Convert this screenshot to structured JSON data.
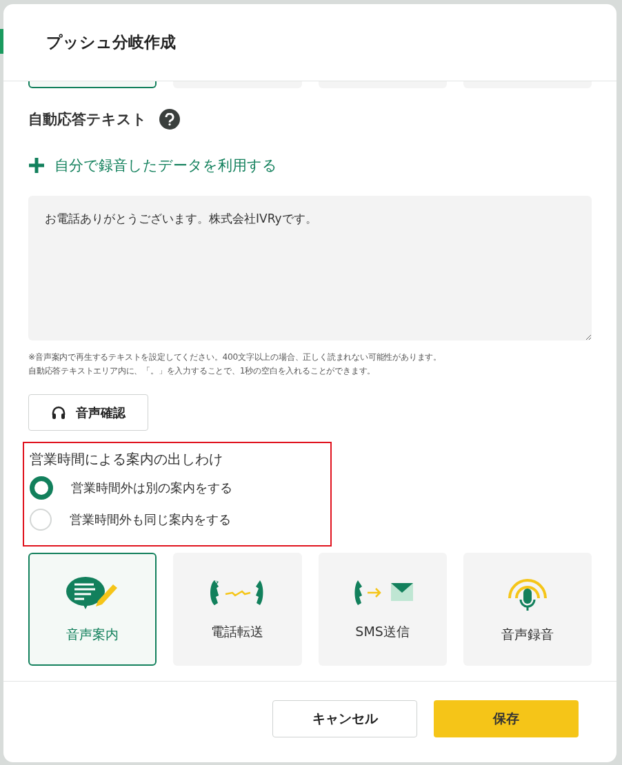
{
  "dialog": {
    "title": "プッシュ分岐作成"
  },
  "auto_text": {
    "label": "自動応答テキスト",
    "add_link": "自分で録音したデータを利用する",
    "value": "お電話ありがとうございます。株式会社IVRyです。",
    "notes": [
      "※音声案内で再生するテキストを設定してください。400文字以上の場合、正しく読まれない可能性があります。",
      "自動応答テキストエリア内に、「。」を入力することで、1秒の空白を入れることができます。"
    ],
    "preview_button": "音声確認"
  },
  "hours": {
    "label": "営業時間による案内の出しわけ",
    "options": [
      {
        "label": "営業時間外は別の案内をする",
        "selected": true
      },
      {
        "label": "営業時間外も同じ案内をする",
        "selected": false
      }
    ]
  },
  "actions": [
    {
      "kind": "voice",
      "label": "音声案内",
      "selected": true
    },
    {
      "kind": "transfer",
      "label": "電話転送",
      "selected": false
    },
    {
      "kind": "sms",
      "label": "SMS送信",
      "selected": false
    },
    {
      "kind": "record",
      "label": "音声録音",
      "selected": false
    }
  ],
  "footer": {
    "cancel": "キャンセル",
    "save": "保存"
  }
}
